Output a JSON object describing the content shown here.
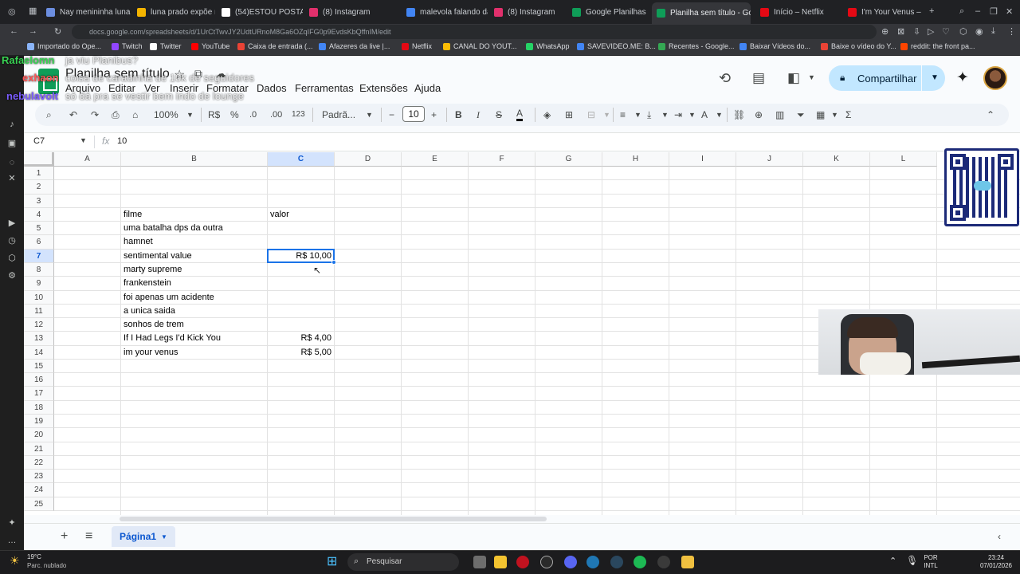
{
  "browser": {
    "tabs": [
      {
        "title": "Nay menininha luna",
        "color": "#6c8ee0"
      },
      {
        "title": "luna prado expõe m",
        "color": "#f4b400"
      },
      {
        "title": "(54)ESTOU POSTAN",
        "color": "#ffffff"
      },
      {
        "title": "(8) Instagram",
        "color": "#e1306c"
      },
      {
        "title": "malevola falando da",
        "color": "#4285f4"
      },
      {
        "title": "(8) Instagram",
        "color": "#e1306c"
      },
      {
        "title": "Google Planilhas",
        "color": "#0f9d58"
      },
      {
        "title": "Planilha sem título - Goog",
        "color": "#0f9d58"
      },
      {
        "title": "Início – Netflix",
        "color": "#e50914"
      },
      {
        "title": "I'm Your Venus – Ne",
        "color": "#e50914"
      }
    ],
    "new_tab": "+",
    "url": "docs.google.com/spreadsheets/d/1UrCtTwvJY2UdtURnoM8Ga6OZqIFG0p9EvdsKbQffnIM/edit",
    "bookmarks": [
      "Importado do Ope...",
      "Twitch",
      "Twitter",
      "YouTube",
      "Caixa de entrada (...",
      "Afazeres da live |...",
      "Netflix",
      "CANAL DO YOUT...",
      "WhatsApp",
      "SAVEVIDEO.ME: B...",
      "Recentes - Google...",
      "Baixar Vídeos do...",
      "Baixe o vídeo do Y...",
      "reddit: the front pa..."
    ]
  },
  "chat": [
    {
      "user": "Rafaelomn",
      "msg": "ja viu Planibus?",
      "color": "#39d353"
    },
    {
      "user": "exhaon",
      "msg": "coisa de caradinha de 10k de seguidores",
      "color": "#ff5555"
    },
    {
      "user": "nebulavolt",
      "msg": "só dá pra se vestir bem indo de lounge",
      "color": "#7a5cff"
    }
  ],
  "sheets": {
    "title": "Planilha sem título",
    "menu": [
      "Arquivo",
      "Editar",
      "Ver",
      "Inserir",
      "Formatar",
      "Dados",
      "Ferramentas",
      "Extensões",
      "Ajuda"
    ],
    "share_label": "Compartilhar",
    "toolbar": {
      "zoom": "100%",
      "currency": "R$",
      "percent": "%",
      "dec_decrease": ".0",
      "dec_increase": ".00",
      "number_format": "123",
      "font": "Padrã...",
      "font_size": "10",
      "minus": "−",
      "plus": "+"
    },
    "name_box": "C7",
    "fx": "fx",
    "formula": "10",
    "columns": [
      "A",
      "B",
      "C",
      "D",
      "E",
      "F",
      "G",
      "H",
      "I",
      "J",
      "K",
      "L"
    ],
    "selected_column": "C",
    "selected_row": 7,
    "rows": [
      1,
      2,
      3,
      4,
      5,
      6,
      7,
      8,
      9,
      10,
      11,
      12,
      13,
      14,
      15,
      16,
      17,
      18,
      19,
      20,
      21,
      22,
      23,
      24,
      25
    ],
    "cells": [
      {
        "ref": "B4",
        "col": 1,
        "row": 4,
        "value": "filme"
      },
      {
        "ref": "C4",
        "col": 2,
        "row": 4,
        "value": "valor"
      },
      {
        "ref": "B5",
        "col": 1,
        "row": 5,
        "value": "uma batalha dps da outra"
      },
      {
        "ref": "B6",
        "col": 1,
        "row": 6,
        "value": "hamnet"
      },
      {
        "ref": "B7",
        "col": 1,
        "row": 7,
        "value": "sentimental value"
      },
      {
        "ref": "C7",
        "col": 2,
        "row": 7,
        "value": "R$ 10,00",
        "num": true
      },
      {
        "ref": "B8",
        "col": 1,
        "row": 8,
        "value": "marty supreme"
      },
      {
        "ref": "B9",
        "col": 1,
        "row": 9,
        "value": "frankenstein"
      },
      {
        "ref": "B10",
        "col": 1,
        "row": 10,
        "value": "foi apenas um acidente"
      },
      {
        "ref": "B11",
        "col": 1,
        "row": 11,
        "value": "a unica saida"
      },
      {
        "ref": "B12",
        "col": 1,
        "row": 12,
        "value": "sonhos de trem"
      },
      {
        "ref": "B13",
        "col": 1,
        "row": 13,
        "value": "If I Had Legs I'd Kick You"
      },
      {
        "ref": "C13",
        "col": 2,
        "row": 13,
        "value": "R$ 4,00",
        "num": true
      },
      {
        "ref": "B14",
        "col": 1,
        "row": 14,
        "value": "im your venus"
      },
      {
        "ref": "C14",
        "col": 2,
        "row": 14,
        "value": "R$ 5,00",
        "num": true
      }
    ],
    "sheet_add": "+",
    "sheet_list": "≡",
    "sheet_tab": "Página1"
  },
  "taskbar": {
    "temperature": "19°C",
    "weather": "Parc. nublado",
    "search": "Pesquisar",
    "lang_top": "POR",
    "lang_bottom": "INTL",
    "time": "23:24",
    "date": "07/01/2026"
  },
  "colors": {
    "accent": "#1a73e8",
    "share_bg": "#c2e7ff",
    "sheets_green": "#0f9d58"
  }
}
